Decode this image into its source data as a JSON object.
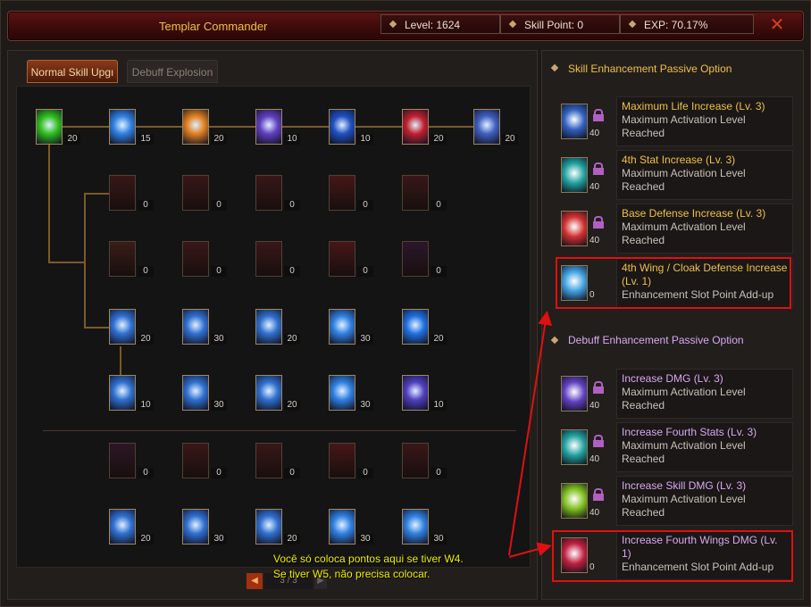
{
  "header": {
    "title": "Templar Commander",
    "level": "Level: 1624",
    "skill_point": "Skill Point: 0",
    "exp": "EXP:  70.17%",
    "close_glyph": "✕"
  },
  "tabs": [
    {
      "label": "Normal Skill Upgı"
    },
    {
      "label": "Debuff Explosion"
    }
  ],
  "skill_tree": {
    "row1": [
      "20",
      "15",
      "20",
      "10",
      "10",
      "20",
      "20"
    ],
    "row2": [
      "0",
      "0",
      "0",
      "0",
      "0"
    ],
    "row3": [
      "0",
      "0",
      "0",
      "0",
      "0"
    ],
    "row4": [
      "20",
      "30",
      "20",
      "30",
      "20"
    ],
    "row5": [
      "10",
      "30",
      "20",
      "30",
      "10"
    ],
    "row6": [
      "0",
      "0",
      "0",
      "0",
      "0"
    ],
    "row7": [
      "20",
      "30",
      "20",
      "30",
      "30"
    ]
  },
  "pager": {
    "prev": "◀",
    "page": "3 / 3",
    "next": "▶"
  },
  "skill_section": {
    "title": "Skill Enhancement Passive Option",
    "options": [
      {
        "name": "Maximum Life Increase (Lv. 3)",
        "desc": "Maximum Activation Level Reached",
        "points": "40",
        "icon_color": "#3060c0"
      },
      {
        "name": "4th Stat Increase (Lv. 3)",
        "desc": "Maximum Activation Level Reached",
        "points": "40",
        "icon_color": "#20a0a0"
      },
      {
        "name": "Base Defense Increase (Lv. 3)",
        "desc": "Maximum Activation Level Reached",
        "points": "40",
        "icon_color": "#d03030"
      },
      {
        "name": "4th Wing / Cloak Defense Increase (Lv. 1)",
        "desc": "Enhancement Slot Point Add-up",
        "points": "0",
        "icon_color": "#40a0e0"
      }
    ]
  },
  "debuff_section": {
    "title": "Debuff Enhancement Passive Option",
    "options": [
      {
        "name": "Increase DMG (Lv. 3)",
        "desc": "Maximum Activation Level Reached",
        "points": "40",
        "icon_color": "#6040c0"
      },
      {
        "name": "Increase Fourth Stats (Lv. 3)",
        "desc": "Maximum Activation Level Reached",
        "points": "40",
        "icon_color": "#20a0a0"
      },
      {
        "name": "Increase Skill DMG (Lv. 3)",
        "desc": "Maximum Activation Level Reached",
        "points": "40",
        "icon_color": "#80c020"
      },
      {
        "name": "Increase Fourth Wings DMG (Lv. 1)",
        "desc": "Enhancement Slot Point Add-up",
        "points": "0",
        "icon_color": "#c02040"
      }
    ]
  },
  "annotation": {
    "line1": "Você só coloca pontos aqui se tiver W4.",
    "line2": "Se tiver W5, não precisa colocar."
  }
}
